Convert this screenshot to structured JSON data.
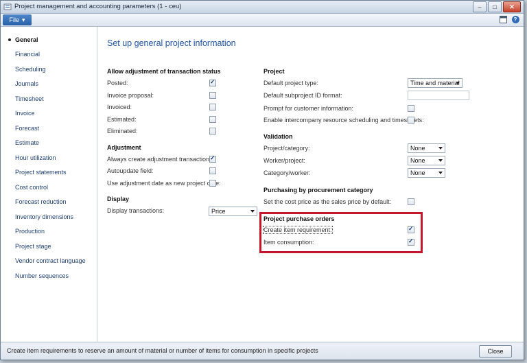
{
  "window": {
    "title": "Project management and accounting parameters (1 - ceu)",
    "btn_minimize": "–",
    "btn_maximize": "□",
    "btn_close": "✕"
  },
  "menubar": {
    "file_label": "File",
    "file_arrow": "▾",
    "help_glyph": "?"
  },
  "sidebar": {
    "items": [
      {
        "label": "General",
        "active": true
      },
      {
        "label": "Financial"
      },
      {
        "label": "Scheduling"
      },
      {
        "label": "Journals"
      },
      {
        "label": "Timesheet"
      },
      {
        "label": "Invoice"
      },
      {
        "label": "Forecast"
      },
      {
        "label": "Estimate"
      },
      {
        "label": "Hour utilization"
      },
      {
        "label": "Project statements"
      },
      {
        "label": "Cost control"
      },
      {
        "label": "Forecast reduction"
      },
      {
        "label": "Inventory dimensions"
      },
      {
        "label": "Production"
      },
      {
        "label": "Project stage"
      },
      {
        "label": "Vendor contract language"
      },
      {
        "label": "Number sequences"
      }
    ]
  },
  "main": {
    "heading": "Set up general project information",
    "allow_adjust": {
      "title": "Allow adjustment of transaction status",
      "items": [
        {
          "label": "Posted:",
          "checked": true
        },
        {
          "label": "Invoice proposal:",
          "checked": false
        },
        {
          "label": "Invoiced:",
          "checked": false
        },
        {
          "label": "Estimated:",
          "checked": false
        },
        {
          "label": "Eliminated:",
          "checked": false
        }
      ]
    },
    "adjustment": {
      "title": "Adjustment",
      "items": [
        {
          "label": "Always create adjustment transaction:",
          "checked": true
        },
        {
          "label": "Autoupdate field:",
          "checked": false
        },
        {
          "label": "Use adjustment date as new project date:",
          "checked": false
        }
      ]
    },
    "display": {
      "title": "Display",
      "transactions_label": "Display transactions:",
      "transactions_value": "Price"
    },
    "project": {
      "title": "Project",
      "default_type_label": "Default project type:",
      "default_type_value": "Time and material",
      "subproject_label": "Default subproject ID format:",
      "subproject_value": "",
      "prompt_label": "Prompt for customer information:",
      "prompt_checked": false,
      "intercompany_label": "Enable intercompany resource scheduling and timesheets:",
      "intercompany_checked": false
    },
    "validation": {
      "title": "Validation",
      "items": [
        {
          "label": "Project/category:",
          "value": "None"
        },
        {
          "label": "Worker/project:",
          "value": "None"
        },
        {
          "label": "Category/worker:",
          "value": "None"
        }
      ]
    },
    "purchasing": {
      "title": "Purchasing by procurement category",
      "cost_price_label": "Set the cost price as the sales price by default:",
      "cost_price_checked": false
    },
    "purchase_orders": {
      "title": "Project purchase orders",
      "create_req_label": "Create item requirement:",
      "create_req_checked": true,
      "consumption_label": "Item consumption:",
      "consumption_checked": true
    }
  },
  "status": {
    "text": "Create item requirements to reserve an amount of material or number of items for consumption in specific projects",
    "close_label": "Close"
  },
  "colors": {
    "accent": "#1f55a4",
    "highlight": "#c4172c",
    "file_button": "#2660a8"
  }
}
